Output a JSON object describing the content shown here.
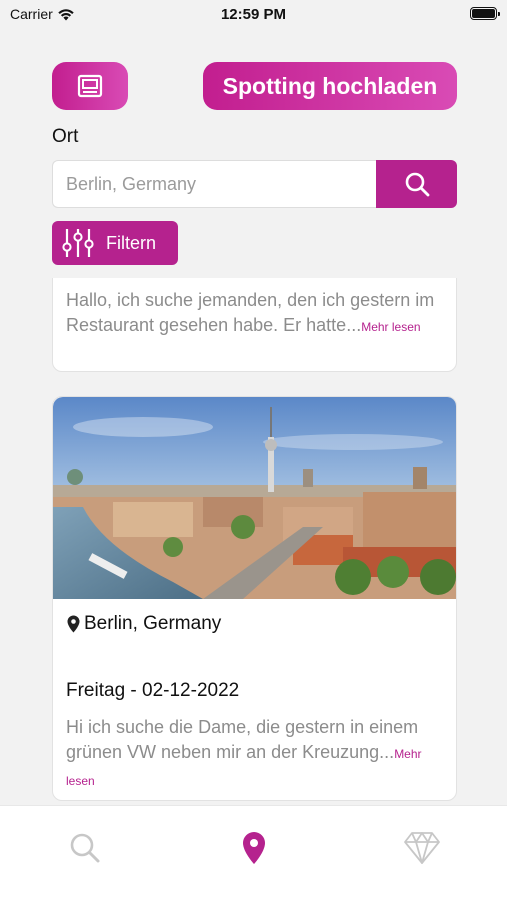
{
  "status_bar": {
    "carrier": "Carrier",
    "time": "12:59 PM"
  },
  "header": {
    "upload_label": "Spotting hochladen"
  },
  "location": {
    "label": "Ort",
    "placeholder": "Berlin, Germany"
  },
  "filter": {
    "label": "Filtern"
  },
  "posts": [
    {
      "text": " Hallo, ich suche jemanden, den ich gestern im Restaurant gesehen habe. Er hatte...",
      "more": "Mehr lesen"
    },
    {
      "location": "Berlin, Germany",
      "date": "Freitag - 02-12-2022",
      "text": " Hi ich suche die Dame, die gestern in einem grünen VW neben mir an der Kreuzung...",
      "more": "Mehr lesen"
    }
  ],
  "tabs": [
    {
      "icon": "search-icon",
      "active": false
    },
    {
      "icon": "location-pin-icon",
      "active": true
    },
    {
      "icon": "diamond-icon",
      "active": false
    }
  ],
  "colors": {
    "accent": "#b5228e",
    "gradient_start": "#c21e8f",
    "gradient_end": "#d94bb5",
    "inactive_icon": "#c7c7c7"
  }
}
